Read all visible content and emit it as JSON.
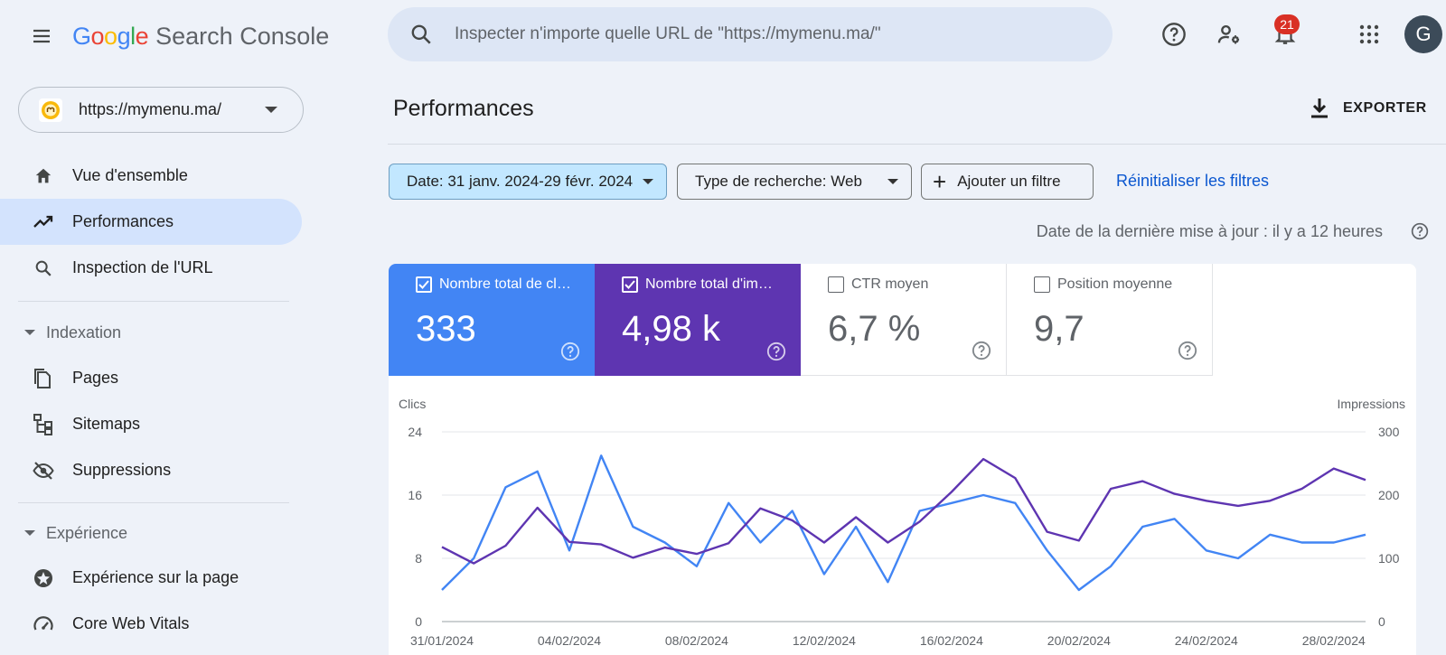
{
  "header": {
    "brand_google": [
      "G",
      "o",
      "o",
      "g",
      "l",
      "e"
    ],
    "brand_colors": [
      "#4285f4",
      "#ea4335",
      "#fbbc05",
      "#4285f4",
      "#34a853",
      "#ea4335"
    ],
    "product": "Search Console",
    "search_placeholder": "Inspecter n'importe quelle URL de \"https://mymenu.ma/\"",
    "notifications_count": "21",
    "avatar_letter": "G"
  },
  "sidebar": {
    "property_url": "https://mymenu.ma/",
    "items": [
      {
        "label": "Vue d'ensemble",
        "icon": "home-icon"
      },
      {
        "label": "Performances",
        "icon": "trending-up-icon",
        "active": true
      },
      {
        "label": "Inspection de l'URL",
        "icon": "search-icon"
      }
    ],
    "sections": [
      {
        "title": "Indexation",
        "items": [
          {
            "label": "Pages",
            "icon": "pages-icon"
          },
          {
            "label": "Sitemaps",
            "icon": "sitemap-icon"
          },
          {
            "label": "Suppressions",
            "icon": "eye-off-icon"
          }
        ]
      },
      {
        "title": "Expérience",
        "items": [
          {
            "label": "Expérience sur la page",
            "icon": "page-experience-icon"
          },
          {
            "label": "Core Web Vitals",
            "icon": "speed-gauge-icon"
          }
        ]
      }
    ]
  },
  "main": {
    "title": "Performances",
    "export_label": "EXPORTER",
    "filters": {
      "date": "Date: 31 janv. 2024-29 févr. 2024",
      "search_type": "Type de recherche: Web",
      "add_filter": "Ajouter un filtre",
      "reset": "Réinitialiser les filtres"
    },
    "last_updated": "Date de la dernière mise à jour : il y a 12 heures",
    "metrics": [
      {
        "label": "Nombre total de clics",
        "value": "333",
        "checked": true,
        "color": "#4285f4"
      },
      {
        "label": "Nombre total d'impressions",
        "value": "4,98 k",
        "checked": true,
        "color": "#5e35b1"
      },
      {
        "label": "CTR moyen",
        "value": "6,7 %",
        "checked": false
      },
      {
        "label": "Position moyenne",
        "value": "9,7",
        "checked": false
      }
    ]
  },
  "chart_data": {
    "type": "line",
    "ylabel_left": "Clics",
    "ylabel_right": "Impressions",
    "ylim_left": [
      0,
      24
    ],
    "ylim_right": [
      0,
      300
    ],
    "yticks_left": [
      "0",
      "8",
      "16",
      "24"
    ],
    "yticks_right": [
      "0",
      "100",
      "200",
      "300"
    ],
    "xtick_labels": [
      "31/01/2024",
      "04/02/2024",
      "08/02/2024",
      "12/02/2024",
      "16/02/2024",
      "20/02/2024",
      "24/02/2024",
      "28/02/2024"
    ],
    "x": [
      "31/01/2024",
      "01/02/2024",
      "02/02/2024",
      "03/02/2024",
      "04/02/2024",
      "05/02/2024",
      "06/02/2024",
      "07/02/2024",
      "08/02/2024",
      "09/02/2024",
      "10/02/2024",
      "11/02/2024",
      "12/02/2024",
      "13/02/2024",
      "14/02/2024",
      "15/02/2024",
      "16/02/2024",
      "17/02/2024",
      "18/02/2024",
      "19/02/2024",
      "20/02/2024",
      "21/02/2024",
      "22/02/2024",
      "23/02/2024",
      "24/02/2024",
      "25/02/2024",
      "26/02/2024",
      "27/02/2024",
      "28/02/2024",
      "29/02/2024"
    ],
    "series": [
      {
        "name": "Clics",
        "axis": "left",
        "color": "#4285f4",
        "values": [
          4,
          8,
          17,
          19,
          9,
          21,
          12,
          10,
          7,
          15,
          10,
          14,
          6,
          12,
          5,
          14,
          15,
          16,
          15,
          9,
          4,
          7,
          12,
          13,
          9,
          8,
          11,
          10,
          10,
          11
        ]
      },
      {
        "name": "Impressions",
        "axis": "right",
        "color": "#5e35b1",
        "values": [
          118,
          92,
          120,
          180,
          126,
          122,
          101,
          117,
          107,
          124,
          179,
          160,
          125,
          165,
          125,
          158,
          205,
          257,
          227,
          142,
          128,
          210,
          222,
          202,
          191,
          183,
          191,
          210,
          242,
          224
        ]
      }
    ],
    "grid": true
  }
}
